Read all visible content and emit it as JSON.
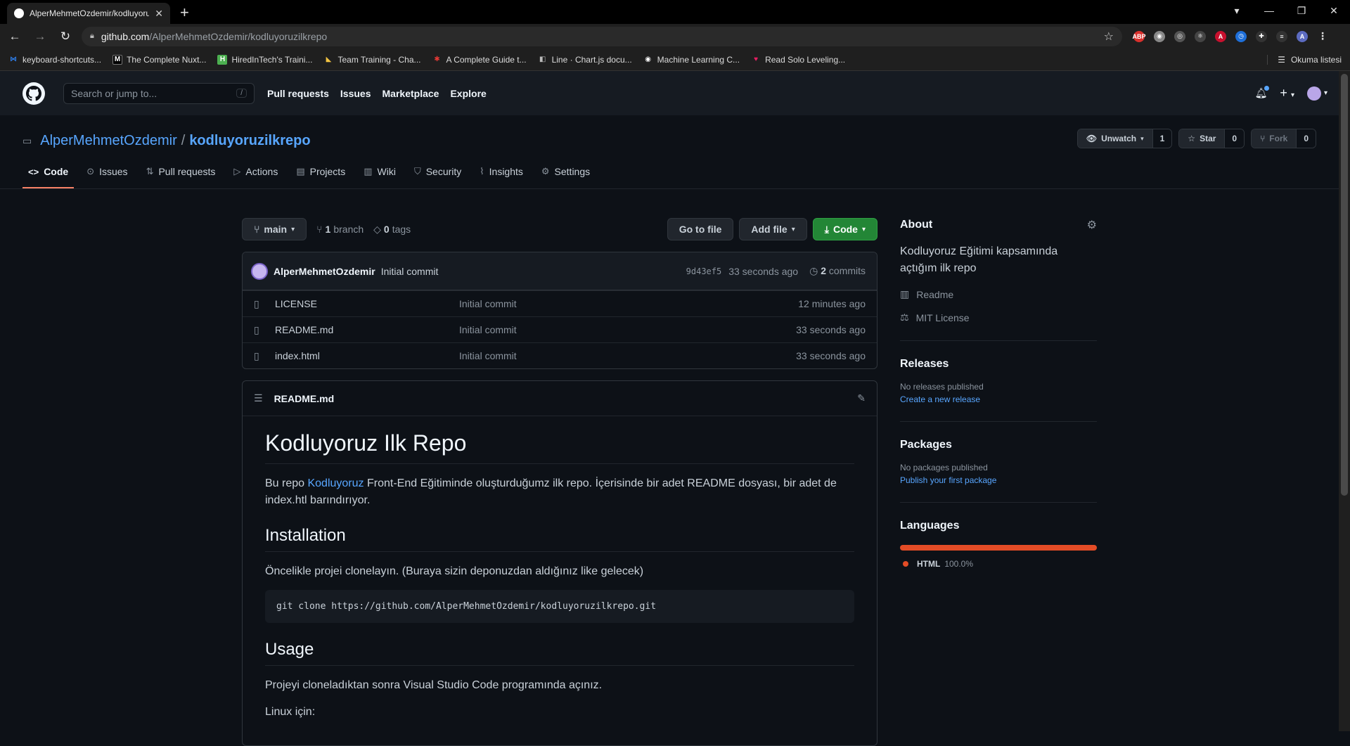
{
  "browser": {
    "tab_title": "AlperMehmetOzdemir/kodluyoruzilkrepo",
    "url_host": "github.com",
    "url_path": "/AlperMehmetOzdemir/kodluyoruzilkrepo",
    "bookmarks": [
      {
        "label": "keyboard-shortcuts...",
        "color": "#2f80ed",
        "glyph": "⋈"
      },
      {
        "label": "The Complete Nuxt...",
        "color": "#ffffff",
        "glyph": "M"
      },
      {
        "label": "HiredInTech's Traini...",
        "color": "#4caf50",
        "glyph": "H"
      },
      {
        "label": "Team Training - Cha...",
        "color": "#f4c542",
        "glyph": "◣"
      },
      {
        "label": "A Complete Guide t...",
        "color": "#e53935",
        "glyph": "✱"
      },
      {
        "label": "Line · Chart.js docu...",
        "color": "#9e9e9e",
        "glyph": "◧"
      },
      {
        "label": "Machine Learning C...",
        "color": "#ffffff",
        "glyph": "◉"
      },
      {
        "label": "Read Solo Leveling...",
        "color": "#e91e63",
        "glyph": "♥"
      }
    ],
    "reading_list": "Okuma listesi",
    "profile_initial": "A"
  },
  "header": {
    "search_placeholder": "Search or jump to...",
    "search_key": "/",
    "nav": [
      "Pull requests",
      "Issues",
      "Marketplace",
      "Explore"
    ]
  },
  "repo": {
    "owner": "AlperMehmetOzdemir",
    "separator": "/",
    "name": "kodluyoruzilkrepo",
    "watch_label": "Unwatch",
    "watch_count": "1",
    "star_label": "Star",
    "star_count": "0",
    "fork_label": "Fork",
    "fork_count": "0",
    "tabs": [
      "Code",
      "Issues",
      "Pull requests",
      "Actions",
      "Projects",
      "Wiki",
      "Security",
      "Insights",
      "Settings"
    ]
  },
  "filenav": {
    "branch": "main",
    "branch_count": "1",
    "branch_word": "branch",
    "tag_count": "0",
    "tag_word": "tags",
    "go_to_file": "Go to file",
    "add_file": "Add file",
    "code": "Code"
  },
  "commit": {
    "author": "AlperMehmetOzdemir",
    "message": "Initial commit",
    "sha": "9d43ef5",
    "age": "33 seconds ago",
    "count": "2",
    "count_word": "commits"
  },
  "files": [
    {
      "name": "LICENSE",
      "commit": "Initial commit",
      "age": "12 minutes ago"
    },
    {
      "name": "README.md",
      "commit": "Initial commit",
      "age": "33 seconds ago"
    },
    {
      "name": "index.html",
      "commit": "Initial commit",
      "age": "33 seconds ago"
    }
  ],
  "readme": {
    "filename": "README.md",
    "h1": "Kodluyoruz Ilk Repo",
    "p1_before": "Bu repo ",
    "p1_link": "Kodluyoruz",
    "p1_after": " Front-End Eğitiminde oluşturduğumz ilk repo. İçerisinde bir adet README dosyası, bir adet de index.htl barındırıyor.",
    "h2_install": "Installation",
    "p_install": "Öncelikle projei clonelayın. (Buraya sizin deponuzdan aldığınız like gelecek)",
    "code": "git clone https://github.com/AlperMehmetOzdemir/kodluyoruzilkrepo.git",
    "h2_usage": "Usage",
    "p_usage": "Projeyi cloneladıktan sonra Visual Studio Code programında açınız.",
    "p_linux": "Linux için:"
  },
  "sidebar": {
    "about_title": "About",
    "description": "Kodluyoruz Eğitimi kapsamında açtığım ilk repo",
    "readme_link": "Readme",
    "license_link": "MIT License",
    "releases_title": "Releases",
    "releases_none": "No releases published",
    "releases_link": "Create a new release",
    "packages_title": "Packages",
    "packages_none": "No packages published",
    "packages_link": "Publish your first package",
    "languages_title": "Languages",
    "language": "HTML",
    "language_pct": "100.0%",
    "language_color": "#e34c26"
  }
}
